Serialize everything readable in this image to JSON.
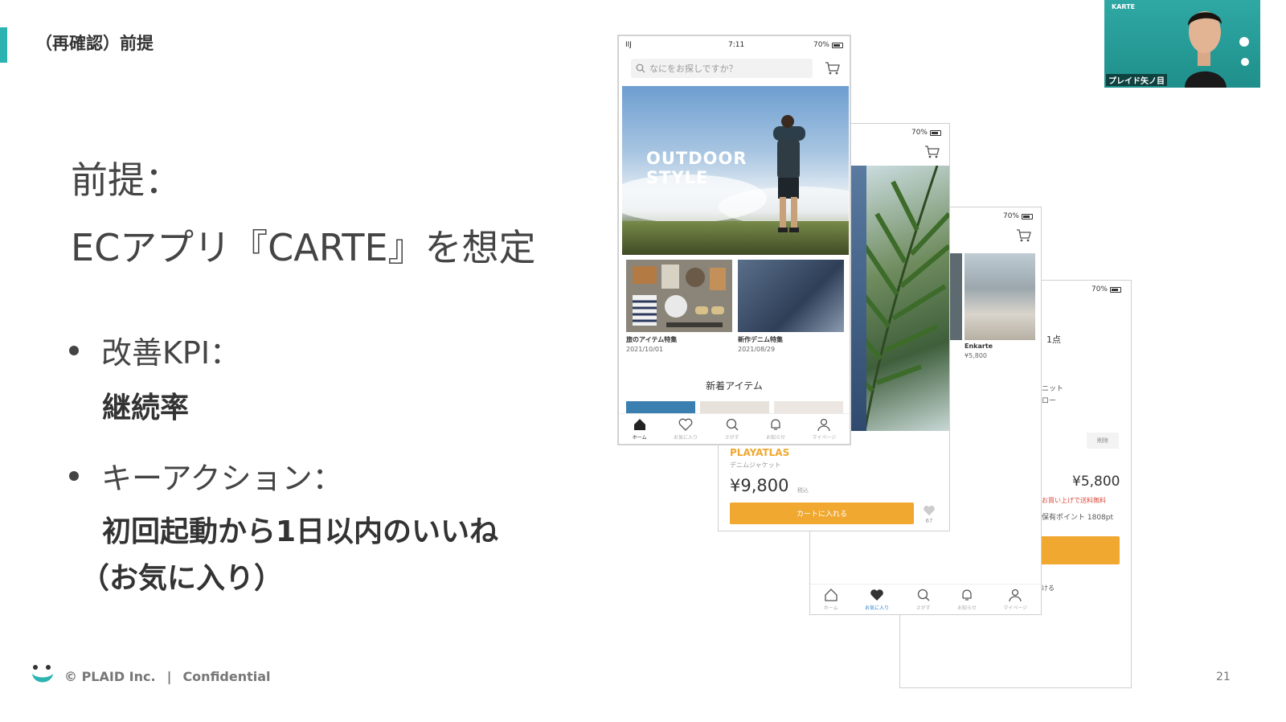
{
  "slide": {
    "section_title": "（再確認）前提",
    "heading_line1": "前提：",
    "heading_line2": "ECアプリ『CARTE』を想定",
    "bullet1_label": "改善KPI：",
    "bullet1_value": "継続率",
    "bullet2_label": "キーアクション：",
    "bullet2_value_line1": "初回起動から1日以内のいいね",
    "bullet2_value_line2": "（お気に入り）",
    "page_number": "21"
  },
  "footer": {
    "copyright": "© PLAID Inc.",
    "separator": "|",
    "confidential": "Confidential"
  },
  "phone_home": {
    "carrier": "IIJ",
    "time": "7:11",
    "battery": "70%",
    "search_placeholder": "なにをお探しですか？",
    "hero_text_line1": "OUTDOOR",
    "hero_text_line2": "STYLE",
    "features": [
      {
        "label": "旅のアイテム特集",
        "date": "2021/10/01"
      },
      {
        "label": "新作デニム特集",
        "date": "2021/08/29"
      }
    ],
    "new_items": "新着アイテム",
    "tabs": [
      "ホーム",
      "お気に入り",
      "さがす",
      "お知らせ",
      "マイページ"
    ]
  },
  "phone_product": {
    "battery": "70%",
    "brand": "PLAYATLAS",
    "category": "デニムジャケット",
    "price": "¥9,800",
    "tax_label": "税込",
    "add_to_cart": "カートに入れる",
    "like_count": "67"
  },
  "phone_favorites": {
    "battery": "70%",
    "item_name": "Enkarte",
    "item_price": "¥5,800",
    "tabs": [
      "ホーム",
      "お気に入り",
      "さがす",
      "お知らせ",
      "マイページ"
    ]
  },
  "phone_cart": {
    "battery": "70%",
    "count": "1点",
    "line1": "ニット",
    "line2": "ロー",
    "delete": "削除",
    "total": "¥5,800",
    "shipping": "お買い上げで送料無料",
    "points": "保有ポイント 1808pt",
    "footer_text": "ける"
  },
  "webcam": {
    "app_label": "KARTE",
    "participant_name": "プレイド矢ノ目"
  },
  "colors": {
    "accent": "#2bb3b1",
    "orange": "#f0a830",
    "sale_red": "#d94a3a"
  }
}
